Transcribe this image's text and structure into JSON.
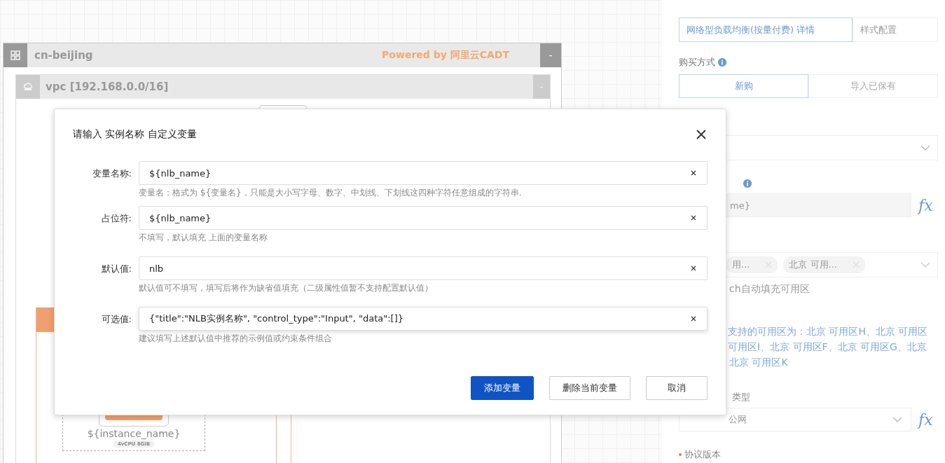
{
  "canvas": {
    "region": {
      "title": "cn-beijing",
      "powered_by": "Powered by 阿里云CADT",
      "collapse": "-"
    },
    "vpc": {
      "title": "vpc [192.168.0.0/16]",
      "collapse": "-"
    },
    "instance": {
      "name": "${instance_name}",
      "spec": "4vCPU 8GiB"
    }
  },
  "dialog": {
    "title": "请输入 实例名称 自定义变量",
    "fields": [
      {
        "label": "变量名称:",
        "value": "${nlb_name}",
        "hint": "变量名：格式为 ${变量名}，只能是大小写字母、数字、中划线、下划线这四种字符任意组成的字符串.",
        "focused": false
      },
      {
        "label": "占位符:",
        "value": "${nlb_name}",
        "hint": "不填写，默认填充 上面的变量名称",
        "focused": false
      },
      {
        "label": "默认值:",
        "value": "nlb",
        "hint": "默认值可不填写，填写后将作为缺省值填充（二级属性值暂不支持配置默认值）",
        "focused": false
      },
      {
        "label": "可选值:",
        "value": "{\"title\":\"NLB实例名称\", \"control_type\":\"Input\", \"data\":[]}",
        "hint": "建议填写上述默认值中推荐的示例值或约束条件组合",
        "focused": true
      }
    ],
    "buttons": [
      {
        "label": "添加变量",
        "kind": "primary"
      },
      {
        "label": "删除当前变量",
        "kind": "default"
      },
      {
        "label": "取消",
        "kind": "default"
      }
    ]
  },
  "panel": {
    "tabs": [
      {
        "label": "网络型负载均衡(按量付费) 详情",
        "selected": true
      },
      {
        "label": "样式配置",
        "selected": false
      }
    ],
    "purchase": {
      "label": "购买方式",
      "options": [
        {
          "label": "新购",
          "selected": true
        },
        {
          "label": "导入已保有",
          "selected": false
        }
      ]
    },
    "name_field": {
      "placeholder": "me}",
      "fx": "fx"
    },
    "zones": {
      "tags": [
        "用...",
        "北京 可用..."
      ],
      "hint": "ch自动填充可用区"
    },
    "zone_note": [
      "支持的可用区为：北京 可用区H、北京 可用区",
      "可用区I、北京 可用区F、北京 可用区G、北京",
      "北京 可用区K"
    ],
    "network_type": {
      "label": "类型",
      "value": "公网",
      "fx": "fx"
    },
    "protocol": {
      "label": "协议版本",
      "required": true
    }
  }
}
